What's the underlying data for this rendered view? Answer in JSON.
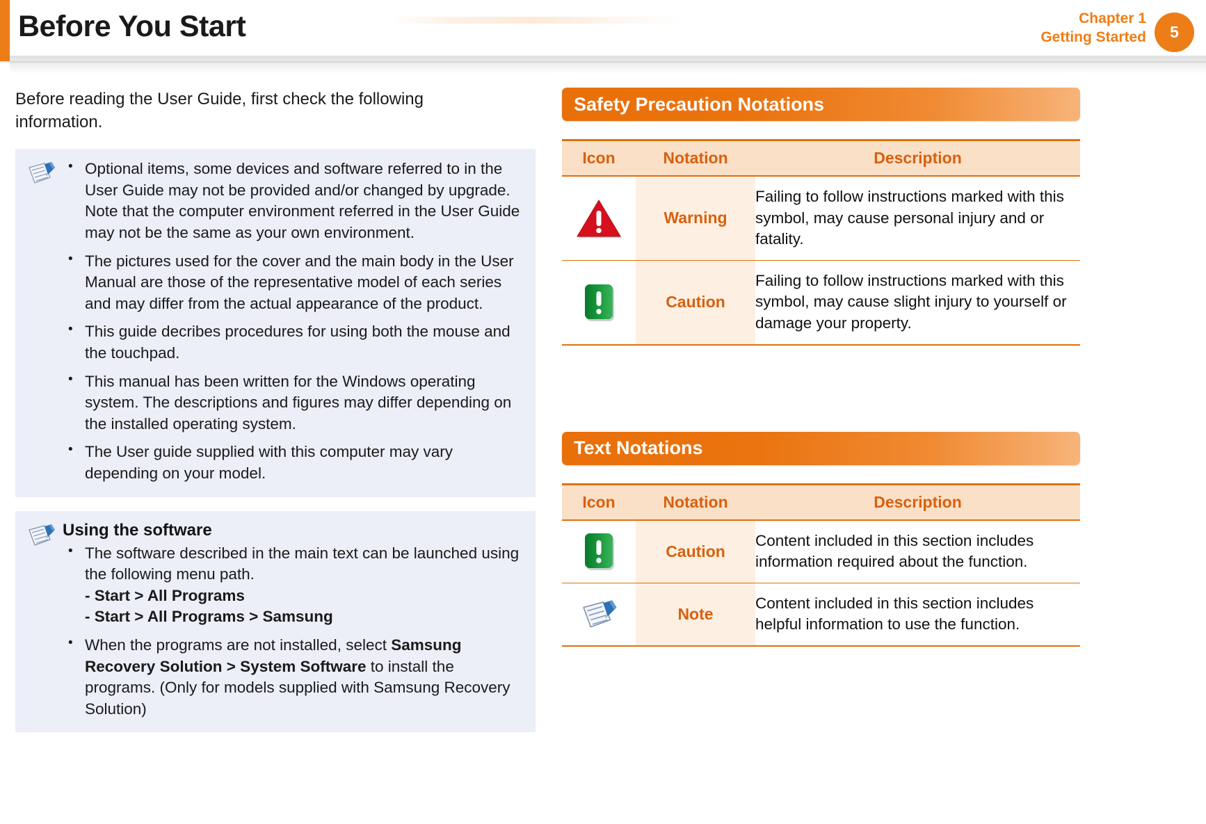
{
  "header": {
    "title": "Before You Start",
    "chapter_line1": "Chapter 1",
    "chapter_line2": "Getting Started",
    "page_number": "5",
    "accent_color": "#ed7d17"
  },
  "left": {
    "intro": "Before reading the User Guide, first check the following information.",
    "note_box_1": {
      "icon": "note-icon",
      "bullets": [
        "Optional items, some devices and software referred to in the User Guide may not be provided and/or changed by upgrade.",
        "Note that the computer environment referred in the User Guide may not be the same as your own environment.",
        "The pictures used for the cover and the main body in the User Manual are those of the representative model of each series and may differ from the actual appearance of the product.",
        "This guide decribes procedures for using both the mouse and the touchpad.",
        "This manual has been written for the Windows operating system. The descriptions and figures may differ depending on the installed operating system.",
        "The User guide supplied with this computer may vary depending on your model."
      ]
    },
    "note_box_2": {
      "icon": "note-icon",
      "heading": "Using the software",
      "bullet1_text": "The software described in the main text can be launched using the following menu path.",
      "bullet1_path1": "- Start > All Programs",
      "bullet1_path2": "- Start > All Programs > Samsung",
      "bullet2_part1": "When the programs are not installed, select ",
      "bullet2_bold1": "Samsung Recovery Solution > System Software",
      "bullet2_part2": " to install the programs. (Only for models supplied with Samsung Recovery Solution)"
    }
  },
  "right": {
    "safety_section": {
      "heading": "Safety Precaution Notations",
      "columns": [
        "Icon",
        "Notation",
        "Description"
      ],
      "rows": [
        {
          "icon": "warning-triangle-icon",
          "notation": "Warning",
          "description": "Failing to follow instructions marked with this symbol, may cause personal injury and or fatality."
        },
        {
          "icon": "caution-square-icon",
          "notation": "Caution",
          "description": "Failing to follow instructions marked with this symbol, may cause slight injury to yourself or damage your property."
        }
      ]
    },
    "text_section": {
      "heading": "Text Notations",
      "columns": [
        "Icon",
        "Notation",
        "Description"
      ],
      "rows": [
        {
          "icon": "caution-square-icon",
          "notation": "Caution",
          "description": "Content included in this section includes information required about the function."
        },
        {
          "icon": "note-icon",
          "notation": "Note",
          "description": "Content included in this section includes helpful information to use the function."
        }
      ]
    }
  }
}
